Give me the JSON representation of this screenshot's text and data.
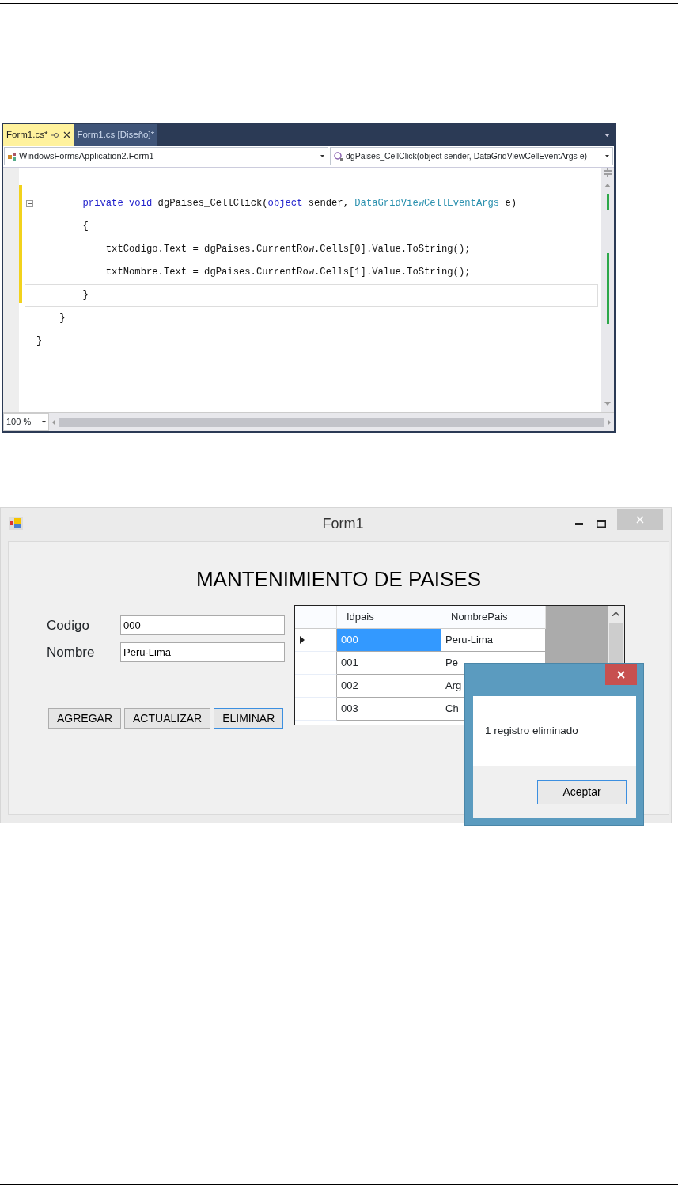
{
  "editor": {
    "tabs": [
      {
        "label": "Form1.cs*",
        "selected": true
      },
      {
        "label": "Form1.cs [Diseño]*",
        "selected": false
      }
    ],
    "class_selector": "WindowsFormsApplication2.Form1",
    "member_selector": "dgPaises_CellClick(object sender, DataGridViewCellEventArgs e)",
    "lines": [
      {
        "current": false,
        "collapsible": true,
        "tokens": [
          {
            "kind": "keyword",
            "text": "        private"
          },
          {
            "kind": "keyword",
            "text": " void"
          },
          {
            "kind": "plain",
            "text": " dgPaises_CellClick("
          },
          {
            "kind": "keyword",
            "text": "object"
          },
          {
            "kind": "plain",
            "text": " sender, "
          },
          {
            "kind": "type",
            "text": "DataGridViewCellEventArgs"
          },
          {
            "kind": "plain",
            "text": " e)"
          }
        ]
      },
      {
        "current": false,
        "collapsible": false,
        "tokens": [
          {
            "kind": "plain",
            "text": "        {"
          }
        ]
      },
      {
        "current": false,
        "collapsible": false,
        "tokens": [
          {
            "kind": "plain",
            "text": "            txtCodigo.Text = dgPaises.CurrentRow.Cells[0].Value.ToString();"
          }
        ]
      },
      {
        "current": false,
        "collapsible": false,
        "tokens": [
          {
            "kind": "plain",
            "text": "            txtNombre.Text = dgPaises.CurrentRow.Cells[1].Value.ToString();"
          }
        ]
      },
      {
        "current": true,
        "collapsible": false,
        "tokens": [
          {
            "kind": "plain",
            "text": "        }"
          }
        ]
      },
      {
        "current": false,
        "collapsible": false,
        "tokens": [
          {
            "kind": "plain",
            "text": "    }"
          }
        ]
      },
      {
        "current": false,
        "collapsible": false,
        "tokens": [
          {
            "kind": "plain",
            "text": "}"
          }
        ]
      }
    ],
    "zoom": "100 %"
  },
  "form": {
    "title": "Form1",
    "heading": "MANTENIMIENTO DE PAISES",
    "fields": [
      {
        "label": "Codigo",
        "value": "000"
      },
      {
        "label": "Nombre",
        "value": "Peru-Lima"
      }
    ],
    "buttons": [
      {
        "label": "AGREGAR",
        "focused": false
      },
      {
        "label": "ACTUALIZAR",
        "focused": false
      },
      {
        "label": "ELIMINAR",
        "focused": true
      }
    ],
    "grid": {
      "columns": [
        "Idpais",
        "NombrePais"
      ],
      "rows": [
        {
          "selected": true,
          "cells": [
            "000",
            "Peru-Lima"
          ]
        },
        {
          "selected": false,
          "cells": [
            "001",
            "Pe"
          ]
        },
        {
          "selected": false,
          "cells": [
            "002",
            "Arg"
          ]
        },
        {
          "selected": false,
          "cells": [
            "003",
            "Ch"
          ]
        }
      ]
    }
  },
  "dialog": {
    "message": "1 registro eliminado",
    "button": "Aceptar"
  }
}
